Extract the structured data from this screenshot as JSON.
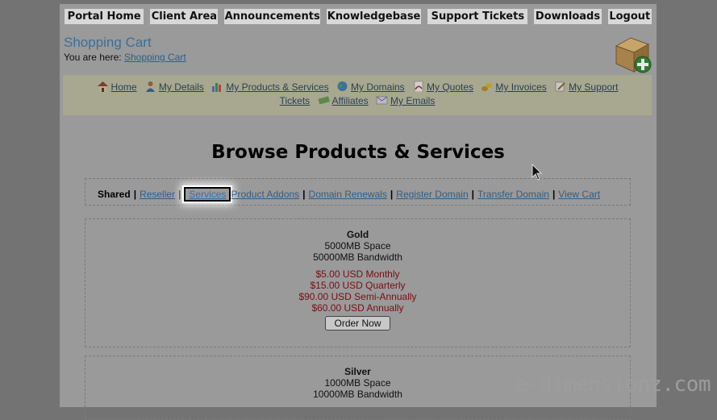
{
  "topnav": [
    "Portal Home",
    "Client Area",
    "Announcements",
    "Knowledgebase",
    "Support Tickets",
    "Downloads",
    "Logout"
  ],
  "cart": {
    "title": "Shopping Cart",
    "crumb_prefix": "You are here:",
    "crumb_link": "Shopping Cart"
  },
  "quicklinks": {
    "row1": [
      {
        "label": "Home",
        "icon": "house-icon"
      },
      {
        "label": "My Details",
        "icon": "user-icon"
      },
      {
        "label": "My Products & Services",
        "icon": "bar-chart-icon"
      },
      {
        "label": "My Domains",
        "icon": "globe-icon"
      },
      {
        "label": "My Quotes",
        "icon": "pdf-icon"
      },
      {
        "label": "My Invoices",
        "icon": "coins-icon"
      },
      {
        "label": "My Support",
        "icon": "edit-icon"
      }
    ],
    "row2": [
      {
        "label": "Tickets",
        "icon": ""
      },
      {
        "label": "Affiliates",
        "icon": "money-icon"
      },
      {
        "label": "My Emails",
        "icon": "envelope-icon"
      }
    ]
  },
  "browse_title": "Browse Products & Services",
  "categories": {
    "current": "Shared",
    "links": [
      "Reseller",
      "Services",
      "Product Addons",
      "Domain Renewals",
      "Register Domain",
      "Transfer Domain",
      "View Cart"
    ],
    "highlighted": "Services"
  },
  "products": [
    {
      "name": "Gold",
      "features": [
        "5000MB Space",
        "50000MB Bandwidth"
      ],
      "prices": [
        "$5.00 USD Monthly",
        "$15.00 USD Quarterly",
        "$90.00 USD Semi-Annually",
        "$60.00 USD Annually"
      ],
      "order_label": "Order Now"
    },
    {
      "name": "Silver",
      "features": [
        "1000MB Space",
        "10000MB Bandwidth"
      ],
      "prices": [],
      "order_label": ""
    }
  ],
  "watermark": "e-dimensionz.com"
}
